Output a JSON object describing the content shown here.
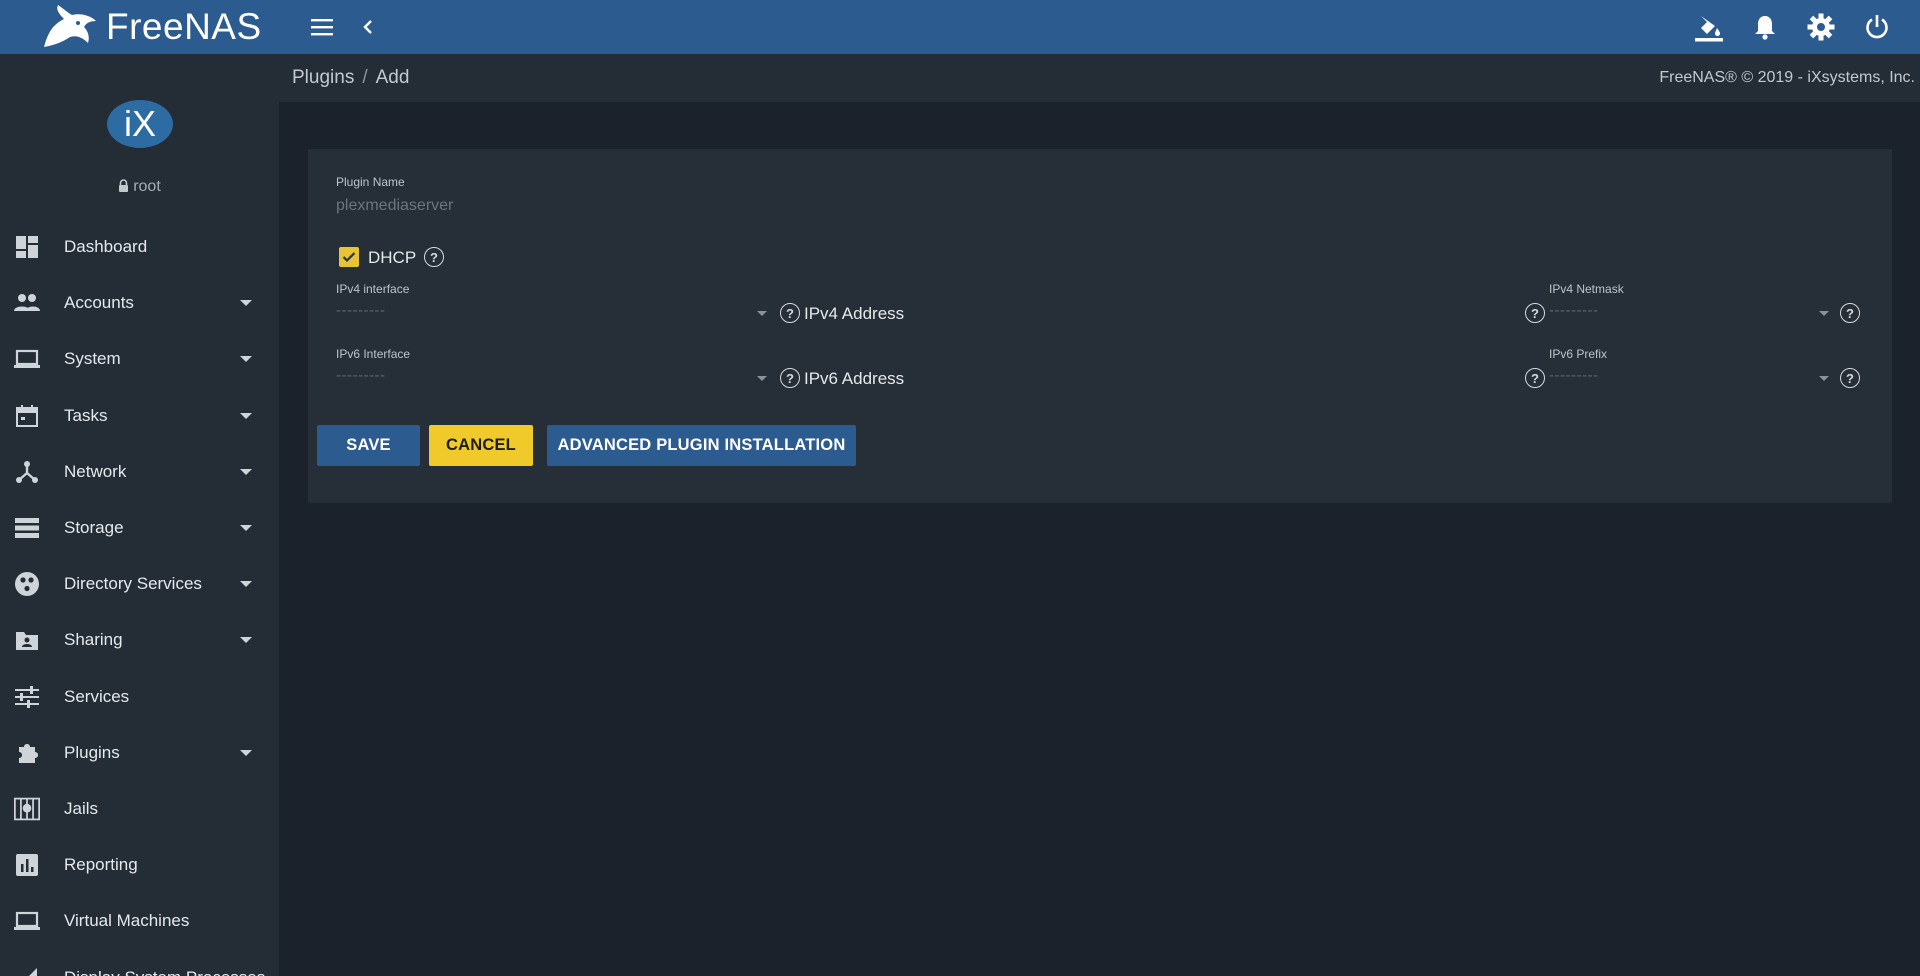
{
  "topbar": {
    "brand": "FreeNAS",
    "brand_tm": "™",
    "icons": [
      "theme-icon",
      "notifications-icon",
      "settings-icon",
      "power-icon"
    ]
  },
  "sidebar": {
    "avatar_text": "iX",
    "username": "root",
    "items": [
      {
        "label": "Dashboard",
        "icon": "dashboard-icon",
        "expandable": false
      },
      {
        "label": "Accounts",
        "icon": "accounts-icon",
        "expandable": true
      },
      {
        "label": "System",
        "icon": "system-icon",
        "expandable": true
      },
      {
        "label": "Tasks",
        "icon": "tasks-icon",
        "expandable": true
      },
      {
        "label": "Network",
        "icon": "network-icon",
        "expandable": true
      },
      {
        "label": "Storage",
        "icon": "storage-icon",
        "expandable": true
      },
      {
        "label": "Directory Services",
        "icon": "directory-services-icon",
        "expandable": true
      },
      {
        "label": "Sharing",
        "icon": "sharing-icon",
        "expandable": true
      },
      {
        "label": "Services",
        "icon": "services-icon",
        "expandable": false
      },
      {
        "label": "Plugins",
        "icon": "plugins-icon",
        "expandable": true
      },
      {
        "label": "Jails",
        "icon": "jails-icon",
        "expandable": false
      },
      {
        "label": "Reporting",
        "icon": "reporting-icon",
        "expandable": false
      },
      {
        "label": "Virtual Machines",
        "icon": "virtual-machines-icon",
        "expandable": false
      },
      {
        "label": "Display System Processes",
        "icon": "processes-icon",
        "expandable": false
      }
    ]
  },
  "breadcrumb": {
    "parent": "Plugins",
    "separator": "/",
    "current": "Add",
    "copyright": "FreeNAS® © 2019 - iXsystems, Inc."
  },
  "form": {
    "plugin_name_label": "Plugin Name",
    "plugin_name_value": "plexmediaserver",
    "dhcp_label": "DHCP",
    "dhcp_checked": true,
    "ipv4_interface_label": "IPv4 interface",
    "ipv4_interface_value": "---------",
    "ipv4_address_label": "IPv4 Address",
    "ipv4_netmask_label": "IPv4 Netmask",
    "ipv4_netmask_value": "---------",
    "ipv6_interface_label": "IPv6 Interface",
    "ipv6_interface_value": "---------",
    "ipv6_address_label": "IPv6 Address",
    "ipv6_prefix_label": "IPv6 Prefix",
    "ipv6_prefix_value": "---------",
    "help_glyph": "?"
  },
  "buttons": {
    "save": "SAVE",
    "cancel": "CANCEL",
    "advanced": "ADVANCED PLUGIN INSTALLATION"
  },
  "colors": {
    "topbar": "#2c5c8f",
    "sidebar": "#242c36",
    "background": "#1b222c",
    "accent_yellow": "#f0c92b",
    "primary_blue": "#2c5c8f"
  }
}
